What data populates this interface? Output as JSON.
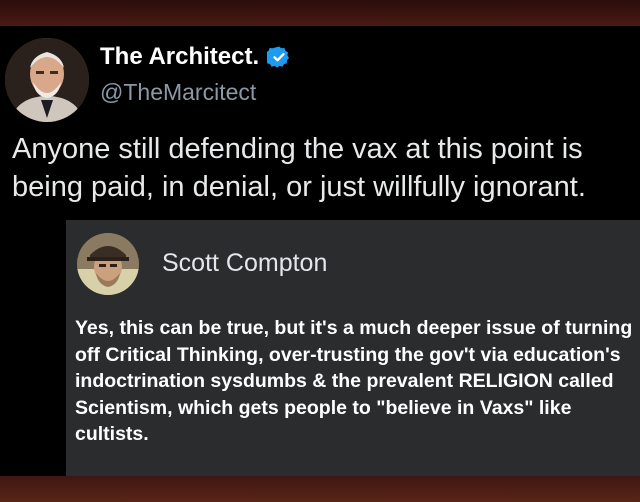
{
  "tweet": {
    "display_name": "The Architect.",
    "handle": "@TheMarcitect",
    "verified_icon": "verified-badge-icon",
    "text": "Anyone still defending the vax at this point is being paid, in denial, or just willfully ignorant.",
    "avatar_icon": "profile-avatar"
  },
  "reply": {
    "name": "Scott Compton",
    "avatar_icon": "profile-avatar",
    "text": "Yes, this can be true, but it's a much deeper issue of turning off Critical Thinking, over-trusting the gov't via education's indoctrination sysdumbs & the prevalent RELIGION called Scientism, which gets people to \"believe in Vaxs\" like cultists."
  },
  "colors": {
    "tweet_background": "#000000",
    "verified_blue": "#1d9bf0",
    "handle_gray": "#8b98a5",
    "card_background": "#2b2c2e",
    "frame": "#3a1410"
  }
}
